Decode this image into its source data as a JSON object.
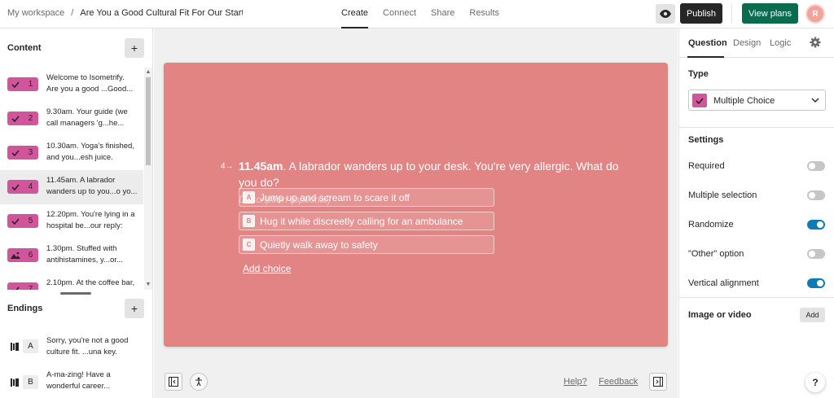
{
  "header": {
    "workspace": "My workspace",
    "separator": "/",
    "form_title": "Are You a Good Cultural Fit For Our Startup",
    "tabs": [
      {
        "label": "Create",
        "active": true
      },
      {
        "label": "Connect",
        "active": false
      },
      {
        "label": "Share",
        "active": false
      },
      {
        "label": "Results",
        "active": false
      }
    ],
    "publish_label": "Publish",
    "view_plans_label": "View plans",
    "avatar_initial": "R",
    "publish_color": "#262627",
    "plans_color": "#0b6b4f"
  },
  "sidebar": {
    "content_label": "Content",
    "endings_label": "Endings",
    "add_symbol": "+",
    "questions": [
      {
        "num": "1",
        "icon": "check-icon",
        "text": "Welcome to Isometrify. Are you a good ...Good..."
      },
      {
        "num": "2",
        "icon": "check-icon",
        "text": "9.30am. Your guide (we call managers 'g...he..."
      },
      {
        "num": "3",
        "icon": "check-icon",
        "text": "10.30am. Yoga's finished, and you...esh juice."
      },
      {
        "num": "4",
        "icon": "check-icon",
        "text": "11.45am. A labrador wanders up to you...o yo...",
        "active": true
      },
      {
        "num": "5",
        "icon": "check-icon",
        "text": "12.20pm. You're lying in a hospital be...our reply:"
      },
      {
        "num": "6",
        "icon": "image-icon",
        "text": "1.30pm. Stuffed with antihistamines, y...or..."
      },
      {
        "num": "7",
        "icon": "check-icon",
        "text": "2.10pm. At the coffee bar,"
      }
    ],
    "endings": [
      {
        "key": "A",
        "text": "Sorry, you're not a good culture fit. ...una key."
      },
      {
        "key": "B",
        "text": "A-ma-zing! Have a wonderful career..."
      }
    ],
    "badge_color": "#d1559a"
  },
  "question": {
    "number": "4",
    "arrow": "→",
    "title_bold": "11.45am",
    "title_rest": ". A labrador wanders up to your desk. You're very allergic. What do you do?",
    "description_placeholder": "Description (optional)",
    "choices": [
      {
        "key": "A",
        "text": "Jump up and scream to scare it off"
      },
      {
        "key": "B",
        "text": "Hug it while discreetly calling for an ambulance"
      },
      {
        "key": "C",
        "text": "Quietly walk away to safety"
      }
    ],
    "add_choice_label": "Add choice",
    "card_color": "#e28484"
  },
  "footer": {
    "help_link": "Help?",
    "feedback_link": "Feedback"
  },
  "panel": {
    "tabs": [
      {
        "label": "Question",
        "active": true
      },
      {
        "label": "Design",
        "active": false
      },
      {
        "label": "Logic",
        "active": false
      }
    ],
    "type_label": "Type",
    "type_value": "Multiple Choice",
    "settings_label": "Settings",
    "settings": [
      {
        "label": "Required",
        "on": false
      },
      {
        "label": "Multiple selection",
        "on": false
      },
      {
        "label": "Randomize",
        "on": true
      },
      {
        "label": "\"Other\" option",
        "on": false
      },
      {
        "label": "Vertical alignment",
        "on": true
      }
    ],
    "media_label": "Image or video",
    "add_label": "Add",
    "help_symbol": "?",
    "toggle_on_color": "#0e7bb5"
  }
}
